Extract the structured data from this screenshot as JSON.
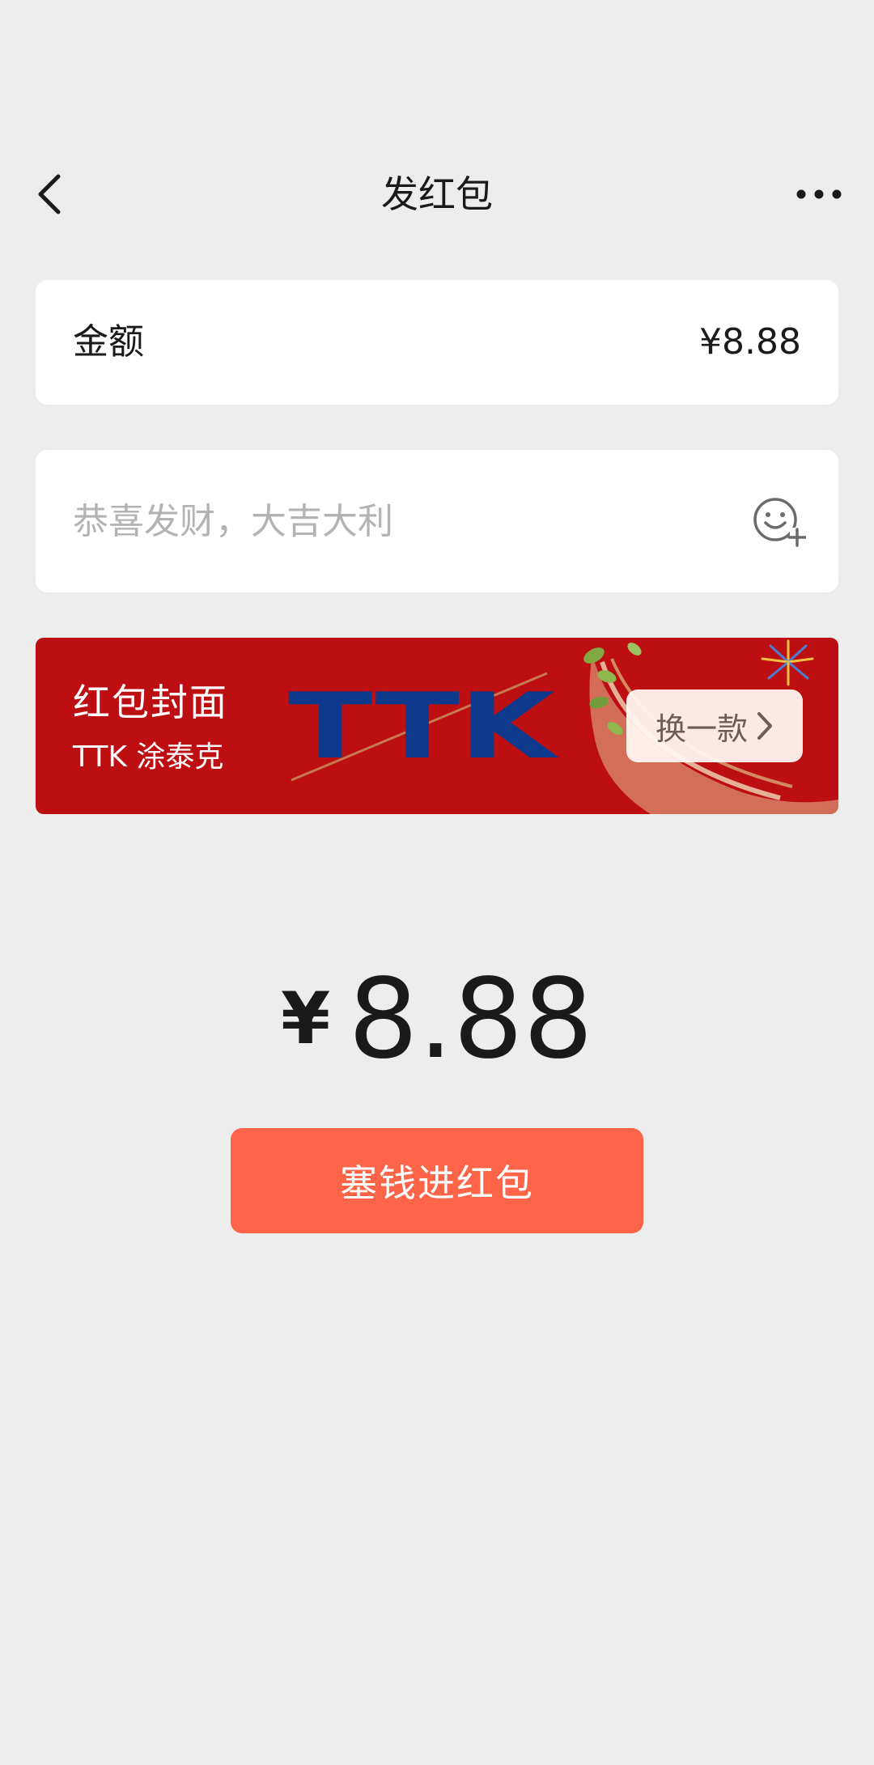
{
  "nav": {
    "title": "发红包",
    "back_icon": "chevron-left-icon",
    "more_icon": "more-horizontal-icon"
  },
  "amount": {
    "label": "金额",
    "value": "¥8.88"
  },
  "greeting": {
    "placeholder": "恭喜发财，大吉大利",
    "value": "",
    "emoji_icon": "emoji-add-icon"
  },
  "cover": {
    "title": "红包封面",
    "subtitle": "TTK 涂泰克",
    "logo_text": "TTK",
    "switch_label": "换一款",
    "background_color": "#bd0e12",
    "logo_color": "#0d3a8c"
  },
  "total": {
    "currency": "¥",
    "amount": "8.88"
  },
  "submit": {
    "label": "塞钱进红包",
    "color": "#fe6548"
  },
  "colors": {
    "page_background": "#ededed",
    "card_background": "#ffffff",
    "placeholder_text": "#b3b3b3"
  }
}
